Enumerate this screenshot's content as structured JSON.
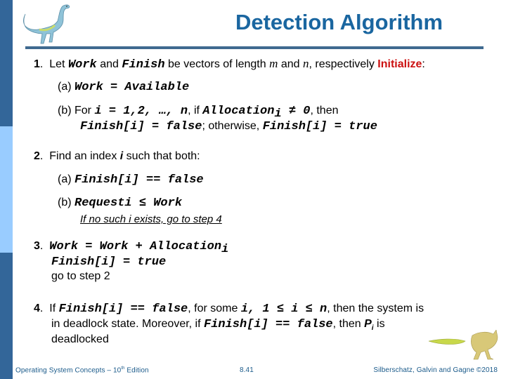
{
  "slide": {
    "title": "Detection Algorithm",
    "sidebar_colors": {
      "dark": "#336699",
      "light": "#99ccff"
    },
    "title_color": "#1a66a0",
    "accent_red": "#cc1111"
  },
  "step1": {
    "num": "1",
    "dot": ".",
    "let": "Let ",
    "work": "Work",
    "and": " and ",
    "finish": "Finish",
    "be_vectors": " be vectors of length ",
    "m": "m",
    "and2": " and ",
    "n": "n",
    "respectively": ", respectively ",
    "initialize": "Initialize",
    "colon": ":",
    "a_label": "(a) ",
    "a_code": "Work = Available",
    "b_label": "(b)  For ",
    "b_code1": "i = 1,2, …, n",
    "b_if": ", if ",
    "b_alloc": "Allocation",
    "b_sub": "i",
    "b_neq": " ≠ 0",
    "b_then": ", then",
    "b_code2": "Finish[i] = false",
    "b_otherwise": "; otherwise, ",
    "b_code3": "Finish[i] = true"
  },
  "step2": {
    "num": "2",
    "dot": ".",
    "text1": "Find an index ",
    "i": "i",
    "text2": " such that both:",
    "a_label": "(a) ",
    "a_code": "Finish[i] == false",
    "b_label": "(b) ",
    "b_code": "Requesti ≤ Work",
    "note": "If no such i exists, go to step 4"
  },
  "step3": {
    "num": "3",
    "dot": ".",
    "code1": "Work = Work + Allocation",
    "code1_sub": "i",
    "code2": "Finish[i] = true",
    "text": "go to step 2"
  },
  "step4": {
    "num": "4",
    "dot": ".",
    "if": "If ",
    "code1": "Finish[i] == false",
    "for_some": ", for some ",
    "code2": "i, 1 ≤ i ≤  n",
    "then_system": ", then the system is",
    "line2_text": "in deadlock state. Moreover, if ",
    "code3": "Finish[i] == false",
    "then_p": ", then ",
    "p": "P",
    "p_sub": "i",
    "is": " is",
    "line3": "deadlocked"
  },
  "footer": {
    "left_prefix": "Operating System Concepts – 10",
    "left_sup": "th",
    "left_suffix": " Edition",
    "page": "8.41",
    "right": "Silberschatz, Galvin and Gagne ©2018"
  },
  "icons": {
    "top_left": "dinosaur-icon",
    "bottom_right": "dinosaur-icon"
  }
}
